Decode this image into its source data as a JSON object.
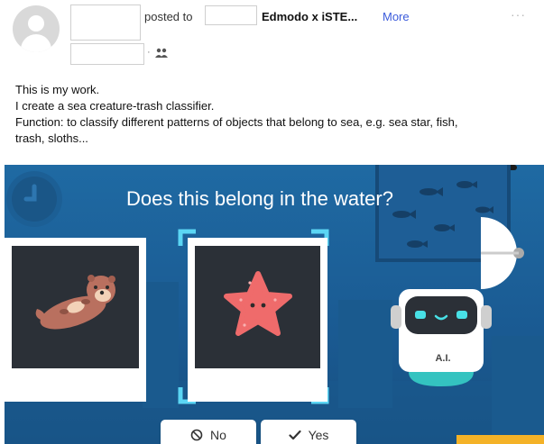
{
  "post": {
    "posted_to": "posted to",
    "group_name": "Edmodo x iSTE...",
    "more_label": "More",
    "overflow": "···",
    "separator": "·",
    "lines": [
      "This is my work.",
      "I create a sea creature-trash classifier.",
      "Function: to classify different patterns of objects that belong to sea, e.g. sea star, fish,",
      "trash, sloths..."
    ]
  },
  "scene": {
    "question": "Does this belong in the water?",
    "robot_label": "A.I.",
    "no_label": "No",
    "yes_label": "Yes"
  },
  "colors": {
    "link": "#3b5bdb",
    "scene_bg": "#1f6aa3",
    "card_dark": "#2b3037",
    "selection": "#5bd6f4",
    "starfish": "#ef6b6b",
    "otter": "#b9705f",
    "robot_eyes": "#48e0e6"
  },
  "icons": [
    "avatar-icon",
    "groups-icon",
    "no-icon",
    "check-icon",
    "clock-icon"
  ]
}
